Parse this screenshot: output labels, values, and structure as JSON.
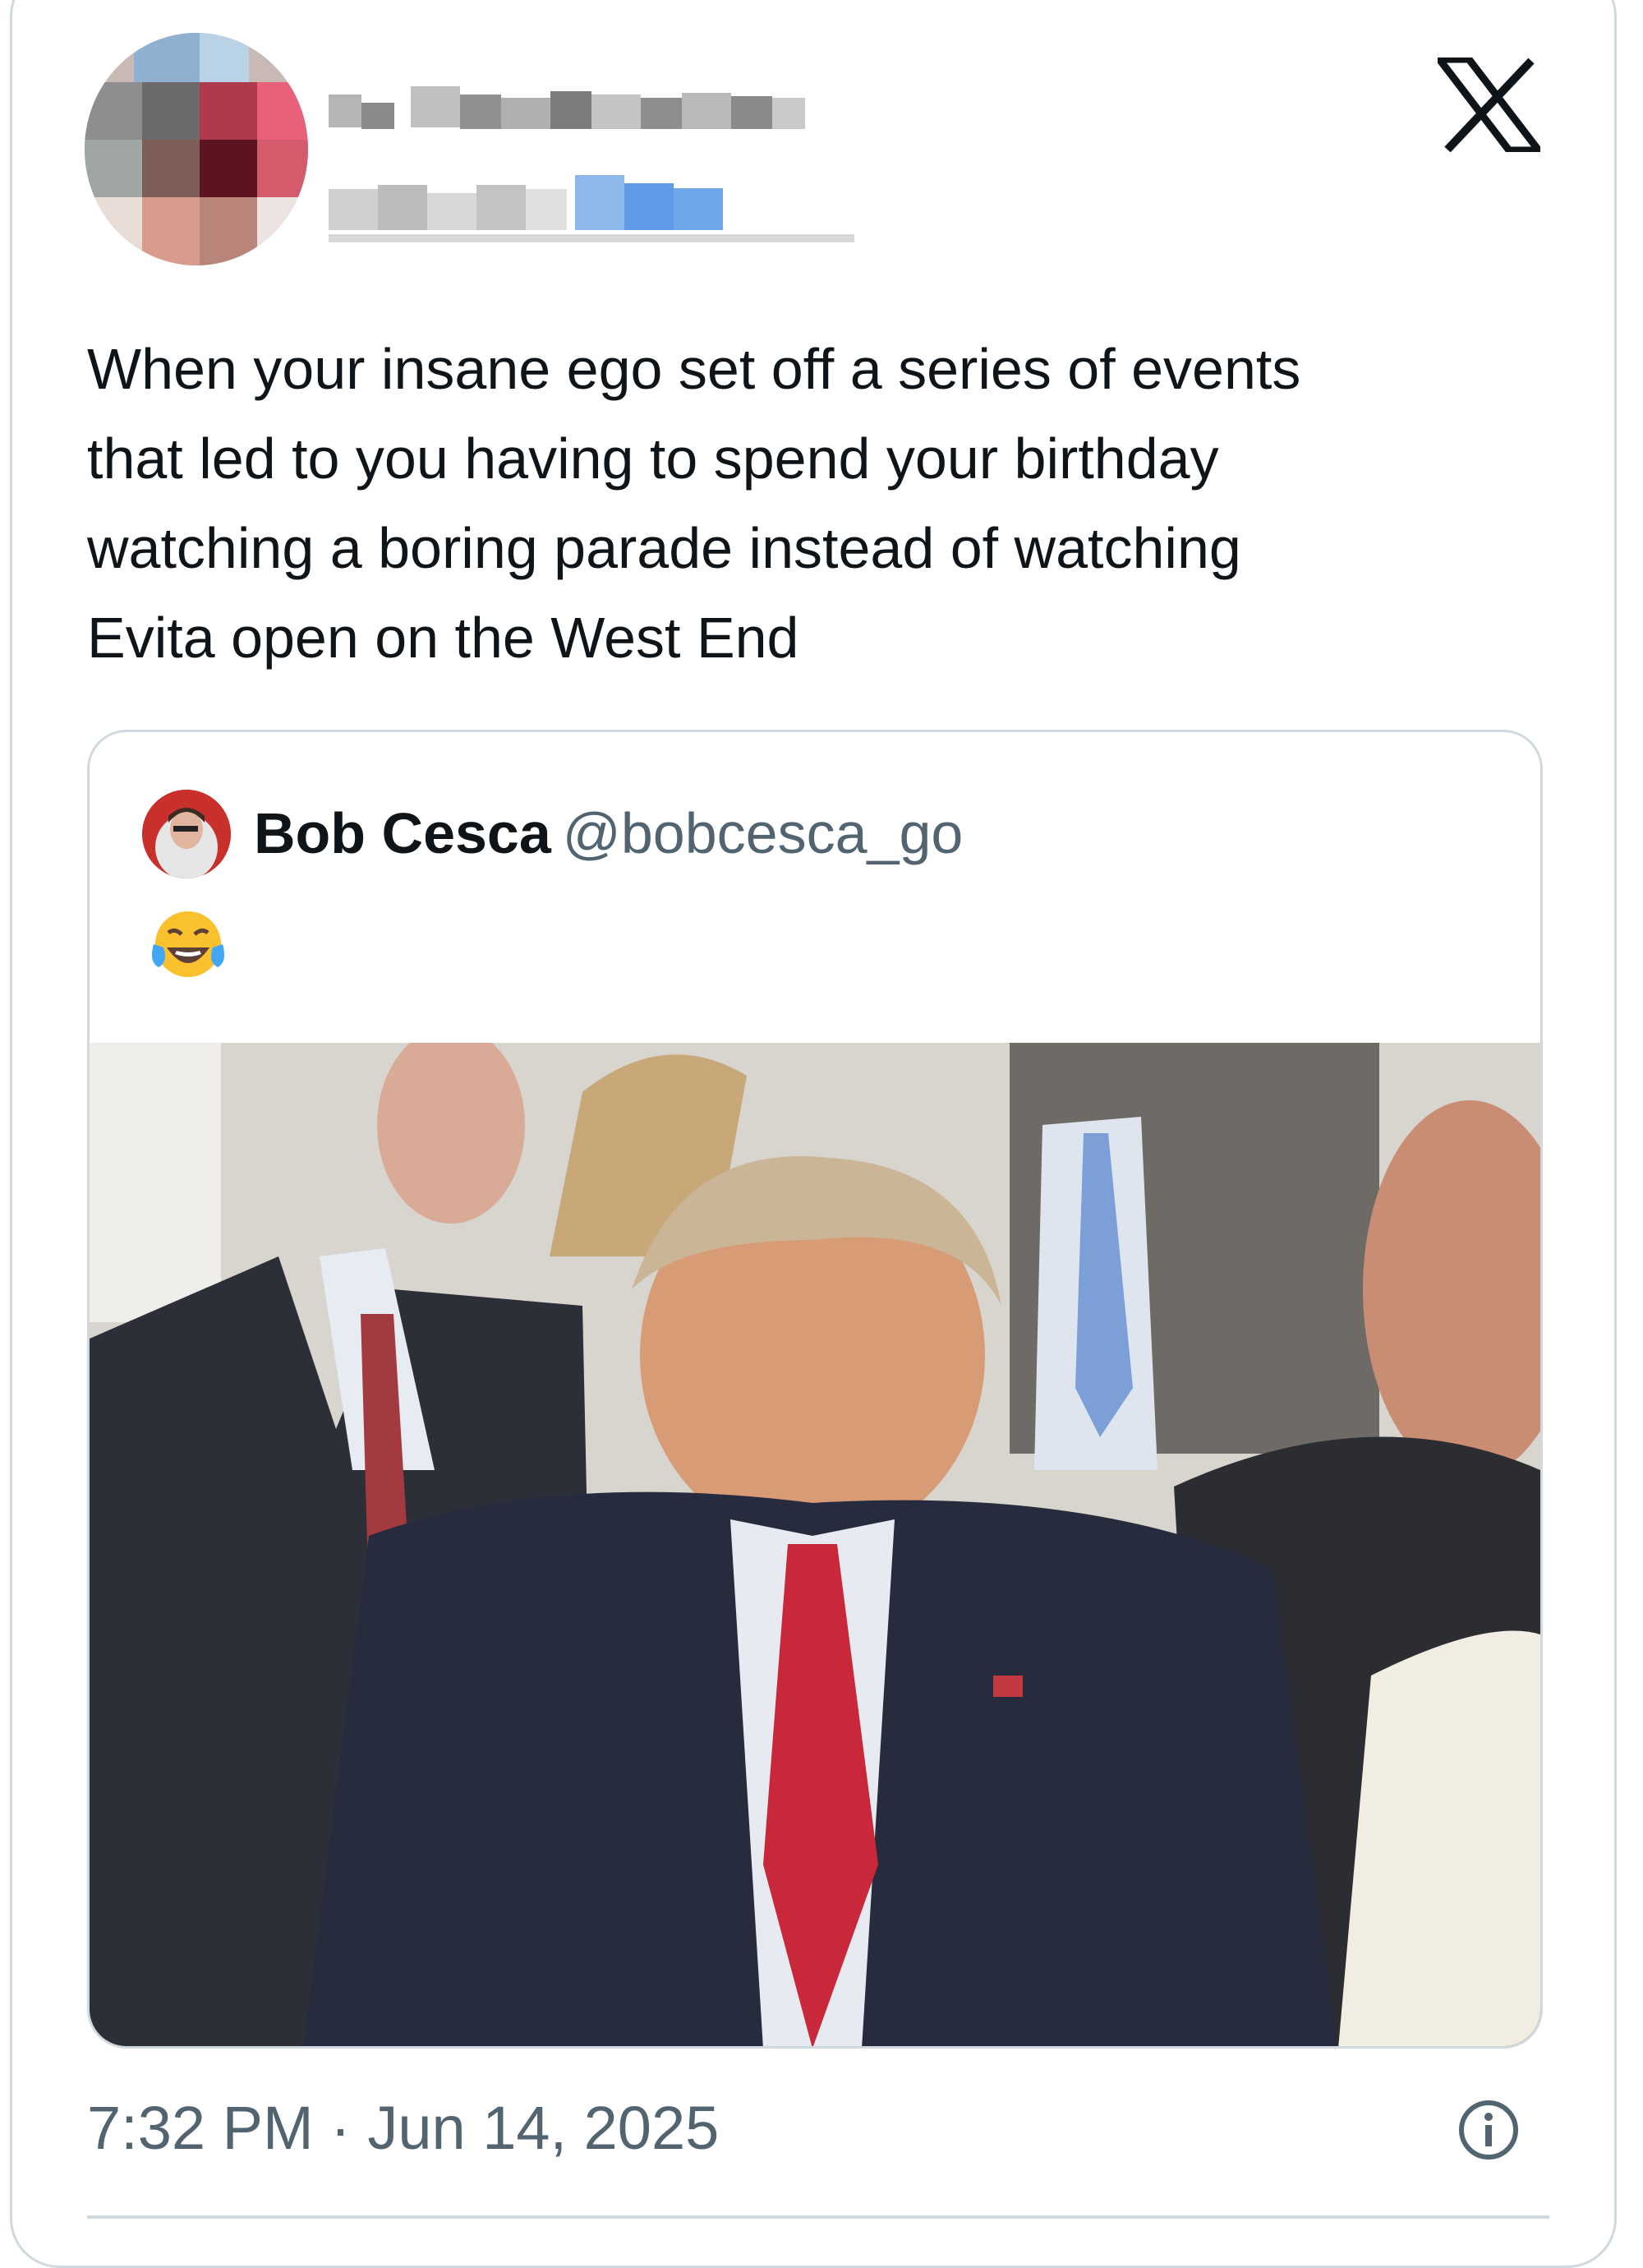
{
  "tweet": {
    "text": "When your insane ego set off a series of events\nthat led to you having to spend your birthday\nwatching a boring parade instead of watching\nEvita open on the West End",
    "timestamp": "7:32 PM · Jun 14, 2025"
  },
  "quoted_tweet": {
    "name": "Bob Cesca",
    "handle": "@bobcesca_go",
    "emoji": "😂"
  },
  "icons": {
    "brand": "x-logo-icon",
    "info": "info-icon"
  },
  "colors": {
    "text": "#0f1419",
    "secondary": "#536471",
    "border": "#cfd9de"
  }
}
